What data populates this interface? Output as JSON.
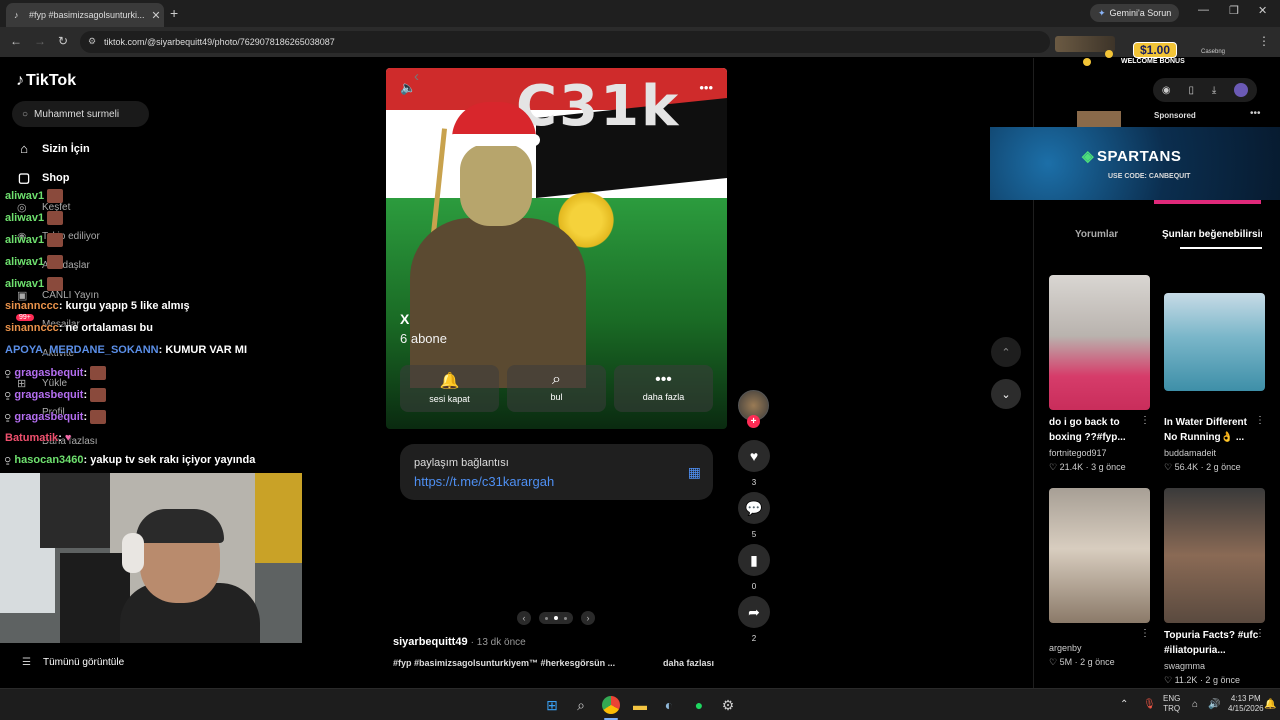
{
  "browser": {
    "tab_title": "#fyp #basimizsagolsunturki...",
    "url": "tiktok.com/@siyarbequitt49/photo/7629078186265038087",
    "gemini_label": "Gemini'a Sorun"
  },
  "overlay_bonus": {
    "amount": "$1.00",
    "label": "WELCOME BONUS",
    "brand": "Casebng"
  },
  "sidebar": {
    "logo": "TikTok",
    "search_value": "Muhammet surmeli",
    "nav_main": [
      "Sizin İçin",
      "Shop"
    ],
    "nav_dim": [
      "Keşfet",
      "Takip ediliyor",
      "Arkadaşlar",
      "CANLI Yayın",
      "Mesajlar",
      "Aktivite",
      "Yükle",
      "Profil",
      "Daha fazlası"
    ],
    "badge": "99+",
    "show_all": "Tümünü görüntüle"
  },
  "chat": [
    {
      "user": "aliwav1",
      "color": "#6ee06e",
      "msg": ""
    },
    {
      "user": "aliwav1",
      "color": "#6ee06e",
      "msg": ""
    },
    {
      "user": "aliwav1",
      "color": "#6ee06e",
      "msg": ""
    },
    {
      "user": "aliwav1",
      "color": "#6ee06e",
      "msg": ""
    },
    {
      "user": "aliwav1",
      "color": "#6ee06e",
      "msg": ""
    },
    {
      "user": "sinannccc",
      "color": "#e9924a",
      "msg": " : kurgu yapıp 5 like almış"
    },
    {
      "user": "sinannccc",
      "color": "#e9924a",
      "msg": " : ne ortalaması bu"
    },
    {
      "user": "APOYA_MERDANE_SOKANN",
      "color": "#5b8fe8",
      "msg": " : KUMUR VAR MI"
    },
    {
      "user": "gragasbequit",
      "color": "#b46ef0",
      "msg": " :"
    },
    {
      "user": "gragasbequit",
      "color": "#b46ef0",
      "msg": " :"
    },
    {
      "user": "gragasbequit",
      "color": "#b46ef0",
      "msg": " :"
    },
    {
      "user": "Batumatik",
      "color": "#f0506e",
      "msg": " :"
    },
    {
      "user": "hasocan3460",
      "color": "#6ee06e",
      "msg": " : yakup tv sek rakı içiyor yayında"
    }
  ],
  "post": {
    "art_text": "C31k",
    "account_name": "X",
    "subscribers": "6 abone",
    "buttons": [
      {
        "label": "sesi kapat",
        "icon": "bell-icon"
      },
      {
        "label": "bul",
        "icon": "search-icon"
      },
      {
        "label": "daha fazla",
        "icon": "more-icon"
      }
    ],
    "link_title": "paylaşım bağlantısı",
    "link_url": "https://t.me/c31karargah",
    "author": "siyarbequitt49",
    "time_ago": "· 13 dk önce",
    "caption": "#fyp #basimizsagolsunturkiyem™ #herkesgörsün ...",
    "caption_more": "daha fazlası",
    "page_index": 2,
    "page_total": 3
  },
  "actions": {
    "likes": "3",
    "comments": "5",
    "saves": "0",
    "shares": "2"
  },
  "right_panel": {
    "sponsored": "Sponsored",
    "ad_brand": "SPARTANS",
    "ad_code": "USE CODE: CANBEQUIT",
    "tabs": [
      "Yorumlar",
      "Şunları beğenebilirsin"
    ],
    "cards": [
      {
        "title": "do i go back to boxing ??#fyp...",
        "user": "fortnitegod917",
        "likes": "♡ 21.4K",
        "ago": "· 3 g önce"
      },
      {
        "title": "In Water Different No Running👌 ...",
        "user": "buddamadeit",
        "likes": "♡ 56.4K",
        "ago": "· 2 g önce"
      },
      {
        "title": "",
        "user": "argenby",
        "likes": "♡ 5M",
        "ago": "· 2 g önce"
      },
      {
        "title": "Topuria Facts? #ufc #iliatopuria...",
        "user": "swagmma",
        "likes": "♡ 11.2K",
        "ago": "· 2 g önce"
      }
    ]
  },
  "taskbar": {
    "lang": "ENG",
    "layout": "TRQ",
    "time": "4:13 PM",
    "date": "4/15/2026"
  }
}
